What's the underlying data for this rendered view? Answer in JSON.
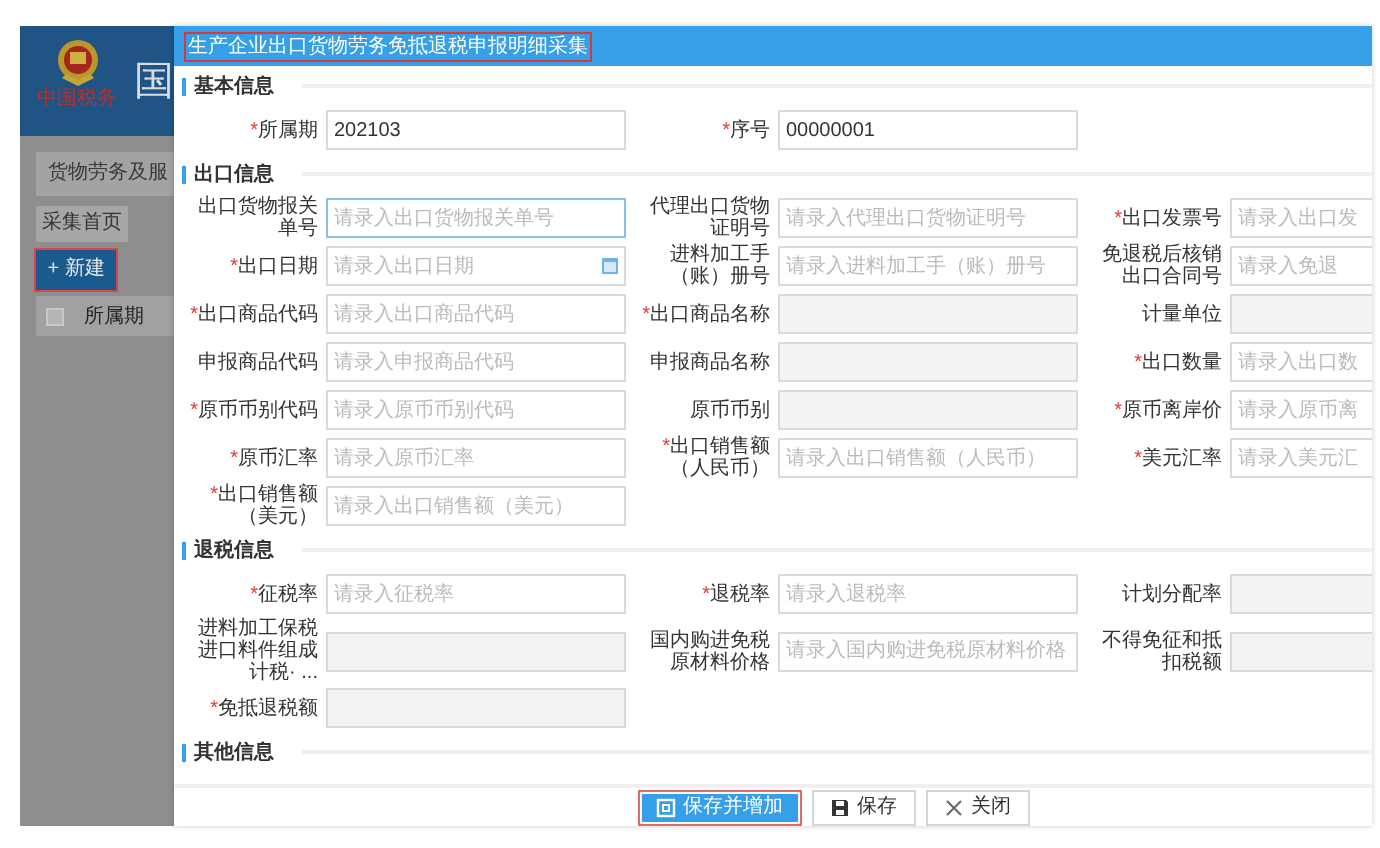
{
  "background_app": {
    "header_title": "国",
    "logo_text": "中国税务",
    "breadcrumb": "货物劳务及服",
    "tabs": [
      {
        "label": "采集首页"
      }
    ],
    "new_button": {
      "icon_text": "+",
      "label": "新建",
      "annotated": true
    },
    "table": {
      "select_all_checked": false,
      "columns": [
        "所属期"
      ]
    }
  },
  "dialog": {
    "title": "生产企业出口货物劳务免抵退税申报明细采集",
    "title_annotated": true,
    "sections": [
      {
        "title": "基本信息",
        "rows": [
          [
            {
              "required_mark": "*",
              "label": "所属期",
              "value": "202103"
            },
            {
              "required_mark": "*",
              "label": "序号",
              "value": "00000001"
            }
          ]
        ]
      },
      {
        "title": "出口信息",
        "rows": [
          [
            {
              "label": "出口货物报关单号",
              "placeholder": "请录入出口货物报关单号",
              "focused": true
            },
            {
              "label": "代理出口货物证明号",
              "placeholder": "请录入代理出口货物证明号"
            },
            {
              "required_mark": "*",
              "label": "出口发票号",
              "placeholder": "请录入出口发"
            }
          ],
          [
            {
              "required_mark": "*",
              "label": "出口日期",
              "placeholder": "请录入出口日期",
              "kind": "date"
            },
            {
              "label": "进料加工手（账）册号",
              "placeholder": "请录入进料加工手（账）册号"
            },
            {
              "label": "免退税后核销出口合同号",
              "placeholder": "请录入免退"
            }
          ],
          [
            {
              "required_mark": "*",
              "label": "出口商品代码",
              "placeholder": "请录入出口商品代码"
            },
            {
              "required_mark": "*",
              "label": "出口商品名称",
              "disabled": true
            },
            {
              "label": "计量单位",
              "disabled": true
            }
          ],
          [
            {
              "label": "申报商品代码",
              "placeholder": "请录入申报商品代码"
            },
            {
              "label": "申报商品名称",
              "disabled": true
            },
            {
              "required_mark": "*",
              "label": "出口数量",
              "placeholder": "请录入出口数"
            }
          ],
          [
            {
              "required_mark": "*",
              "label": "原币币别代码",
              "placeholder": "请录入原币币别代码"
            },
            {
              "label": "原币币别",
              "disabled": true
            },
            {
              "required_mark": "*",
              "label": "原币离岸价",
              "placeholder": "请录入原币离"
            }
          ],
          [
            {
              "required_mark": "*",
              "label": "原币汇率",
              "placeholder": "请录入原币汇率"
            },
            {
              "required_mark": "*",
              "label": "出口销售额（人民币）",
              "placeholder": "请录入出口销售额（人民币）"
            },
            {
              "required_mark": "*",
              "label": "美元汇率",
              "placeholder": "请录入美元汇"
            }
          ],
          [
            {
              "required_mark": "*",
              "label": "出口销售额（美元）",
              "placeholder": "请录入出口销售额（美元）"
            }
          ]
        ]
      },
      {
        "title": "退税信息",
        "rows": [
          [
            {
              "required_mark": "*",
              "label": "征税率",
              "placeholder": "请录入征税率"
            },
            {
              "required_mark": "*",
              "label": "退税率",
              "placeholder": "请录入退税率"
            },
            {
              "label": "计划分配率",
              "disabled": true
            }
          ],
          [
            {
              "label": "进料加工保税进口料件组成计税· ...",
              "disabled": true
            },
            {
              "label": "国内购进免税原材料价格",
              "placeholder": "请录入国内购进免税原材料价格"
            },
            {
              "label": "不得免征和抵扣税额",
              "disabled": true
            }
          ],
          [
            {
              "required_mark": "*",
              "label": "免抵退税额",
              "disabled": true
            }
          ]
        ]
      },
      {
        "title": "其他信息"
      }
    ],
    "buttons": [
      {
        "label": "保存并增加",
        "kind": "primary",
        "annotated": true
      },
      {
        "label": "保存",
        "kind": "save"
      },
      {
        "label": "关闭",
        "kind": "close"
      }
    ]
  }
}
